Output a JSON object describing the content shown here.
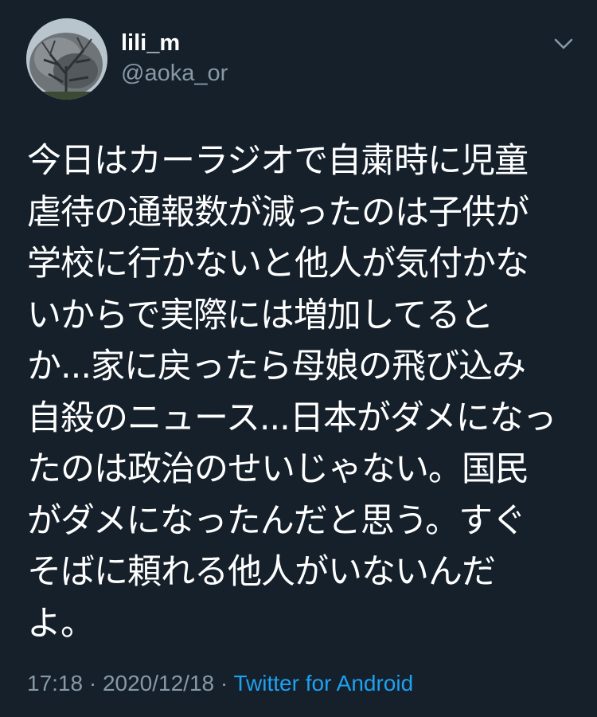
{
  "author": {
    "display_name": "lili_m",
    "handle": "@aoka_or"
  },
  "tweet": {
    "text": "今日はカーラジオで自粛時に児童\n虐待の通報数が減ったのは子供が\n学校に行かないと他人が気付かな\nいからで実際には増加してると\nか...家に戻ったら母娘の飛び込み\n自殺のニュース...日本がダメになっ\nたのは政治のせいじゃない。国民\nがダメになったんだと思う。すぐ\nそばに頼れる他人がいないんだ\nよ。",
    "time": "17:18",
    "date": "2020/12/18",
    "separator": "·",
    "source": "Twitter for Android"
  },
  "icons": {
    "avatar": "profile-photo-tree",
    "menu": "chevron-down-icon"
  },
  "colors": {
    "background": "#15202b",
    "text": "#ffffff",
    "secondary_text": "#8899a6",
    "link": "#1da1f2"
  }
}
